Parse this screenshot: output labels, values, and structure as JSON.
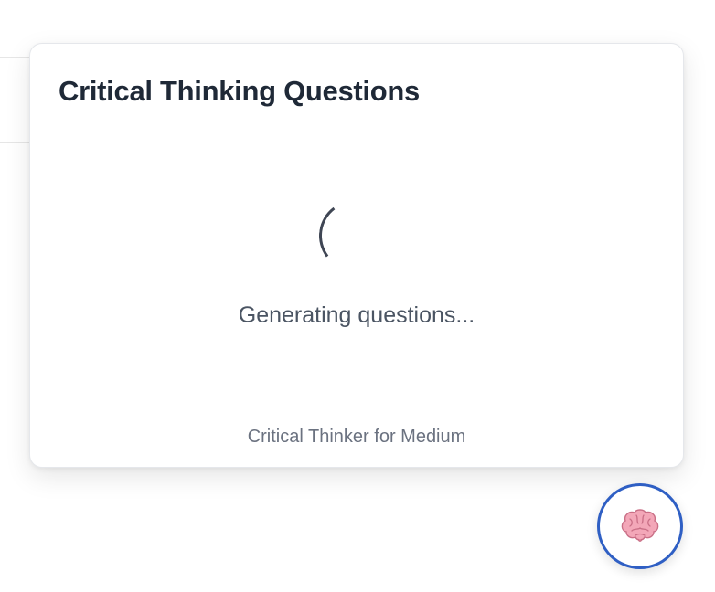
{
  "panel": {
    "title": "Critical Thinking Questions",
    "loading_text": "Generating questions...",
    "footer_text": "Critical Thinker for Medium"
  },
  "fab": {
    "icon": "brain-icon"
  },
  "colors": {
    "title": "#1f2937",
    "muted_text": "#4b5563",
    "footer_text": "#6b7280",
    "fab_border": "#2f5fc4",
    "brain_pink": "#f3a7b8"
  }
}
